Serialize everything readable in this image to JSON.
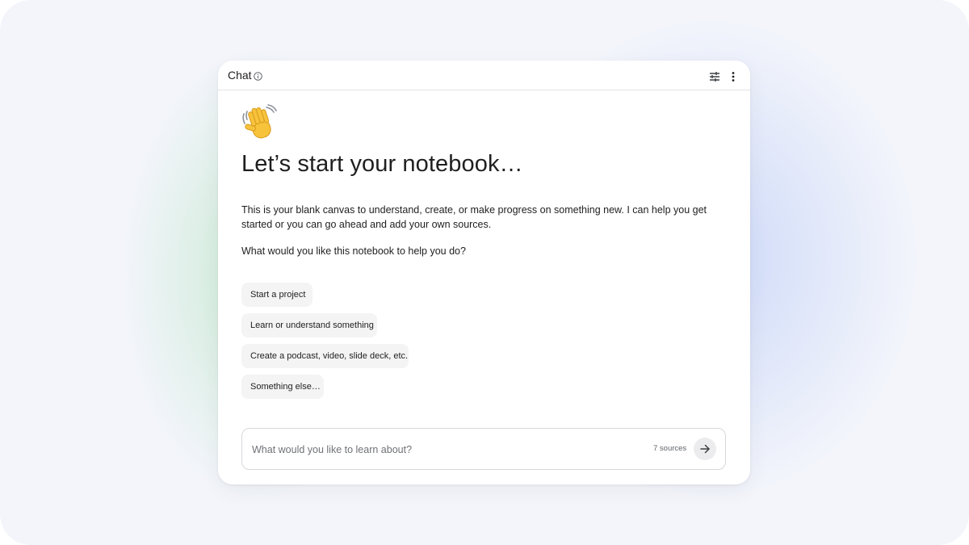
{
  "header": {
    "title": "Chat",
    "info_icon": "info-icon",
    "tune_icon": "tune-icon",
    "more_icon": "more-vert-icon"
  },
  "hero": {
    "emoji": "waving-hand",
    "headline": "Let’s start your notebook…",
    "intro": "This is your blank canvas to understand, create, or make progress on something new. I can help you get started or you can go ahead and add your own sources.",
    "question": "What would you like this notebook to help you do?"
  },
  "suggestions": [
    "Start a project",
    "Learn or understand something",
    "Create a podcast, video, slide deck, etc.",
    "Something else…"
  ],
  "composer": {
    "placeholder": "What would you like to learn about?",
    "sources_count": "7 sources",
    "send_icon": "arrow-right-icon"
  },
  "colors": {
    "page_background": "#f3f5fb",
    "panel": "#ffffff",
    "chip_background": "#f4f4f5",
    "text": "#1f1f1f",
    "muted_text": "#5f6368",
    "green_glow": "#c4e8ce",
    "blue_glow": "#c9d6f8"
  }
}
